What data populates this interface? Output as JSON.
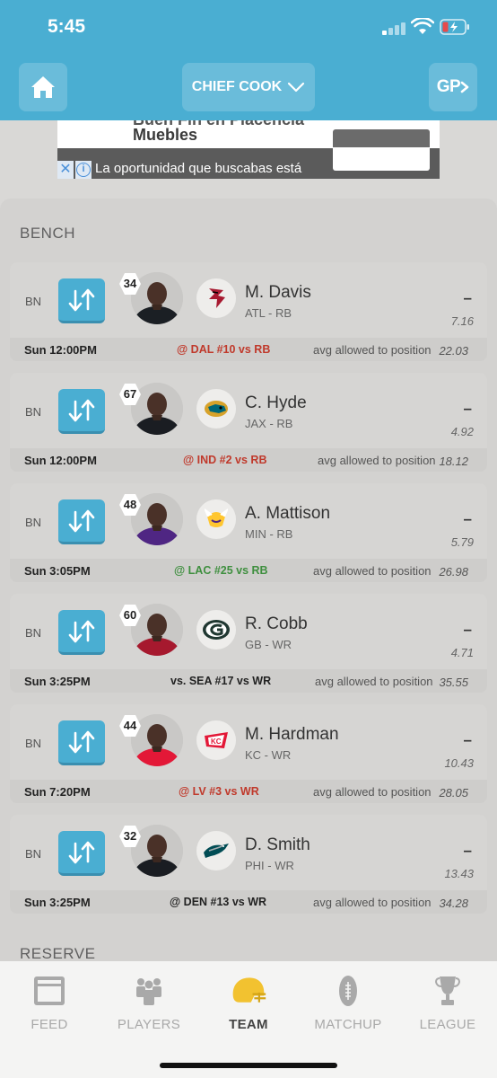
{
  "status_bar": {
    "time": "5:45"
  },
  "header": {
    "team_name": "CHIEF COOK",
    "gp_label": "GP"
  },
  "ad": {
    "cut_line": "Buen Fin en Placencia",
    "headline": "Muebles",
    "body": "La oportunidad que buscabas está",
    "close": "✕",
    "info": "i"
  },
  "sections": {
    "bench": "BENCH",
    "reserve": "RESERVE"
  },
  "players": [
    {
      "slot": "BN",
      "rank": "34",
      "name": "M. Davis",
      "team_pos": "ATL - RB",
      "points": "–",
      "projection": "7.16",
      "game_time": "Sun 12:00PM",
      "matchup": "@ DAL #10 vs RB",
      "avg_label": "avg allowed to position",
      "avg_value": "22.03",
      "team": "ATL",
      "jersey_color": "#1b1f24",
      "matchup_color": "#c0392b"
    },
    {
      "slot": "BN",
      "rank": "67",
      "name": "C. Hyde",
      "team_pos": "JAX - RB",
      "points": "–",
      "projection": "4.92",
      "game_time": "Sun 12:00PM",
      "matchup": "@ IND #2 vs RB",
      "avg_label": "avg allowed to position",
      "avg_value": "18.12",
      "team": "JAX",
      "jersey_color": "#1a1d22",
      "matchup_color": "#c0392b"
    },
    {
      "slot": "BN",
      "rank": "48",
      "name": "A. Mattison",
      "team_pos": "MIN - RB",
      "points": "–",
      "projection": "5.79",
      "game_time": "Sun 3:05PM",
      "matchup": "@ LAC #25 vs RB",
      "avg_label": "avg allowed to position",
      "avg_value": "26.98",
      "team": "MIN",
      "jersey_color": "#4f2683",
      "matchup_color": "#3f8f3f"
    },
    {
      "slot": "BN",
      "rank": "60",
      "name": "R. Cobb",
      "team_pos": "GB - WR",
      "points": "–",
      "projection": "4.71",
      "game_time": "Sun 3:25PM",
      "matchup": "vs. SEA #17 vs WR",
      "avg_label": "avg allowed to position",
      "avg_value": "35.55",
      "team": "GB",
      "jersey_color": "#a6192e",
      "matchup_color": "#222222"
    },
    {
      "slot": "BN",
      "rank": "44",
      "name": "M. Hardman",
      "team_pos": "KC - WR",
      "points": "–",
      "projection": "10.43",
      "game_time": "Sun 7:20PM",
      "matchup": "@ LV #3 vs WR",
      "avg_label": "avg allowed to position",
      "avg_value": "28.05",
      "team": "KC",
      "jersey_color": "#e31837",
      "matchup_color": "#c0392b"
    },
    {
      "slot": "BN",
      "rank": "32",
      "name": "D. Smith",
      "team_pos": "PHI - WR",
      "points": "–",
      "projection": "13.43",
      "game_time": "Sun 3:25PM",
      "matchup": "@ DEN #13 vs WR",
      "avg_label": "avg allowed to position",
      "avg_value": "34.28",
      "team": "PHI",
      "jersey_color": "#1a1d22",
      "matchup_color": "#222222"
    }
  ],
  "tabs": [
    {
      "label": "FEED",
      "icon": "feed-icon",
      "active": false
    },
    {
      "label": "PLAYERS",
      "icon": "players-icon",
      "active": false
    },
    {
      "label": "TEAM",
      "icon": "helmet-icon",
      "active": true
    },
    {
      "label": "MATCHUP",
      "icon": "football-icon",
      "active": false
    },
    {
      "label": "LEAGUE",
      "icon": "trophy-icon",
      "active": false
    }
  ],
  "colors": {
    "accent": "#4aaed2",
    "active_tab_icon": "#f2c230",
    "inactive_tab": "#a9a9a9"
  }
}
